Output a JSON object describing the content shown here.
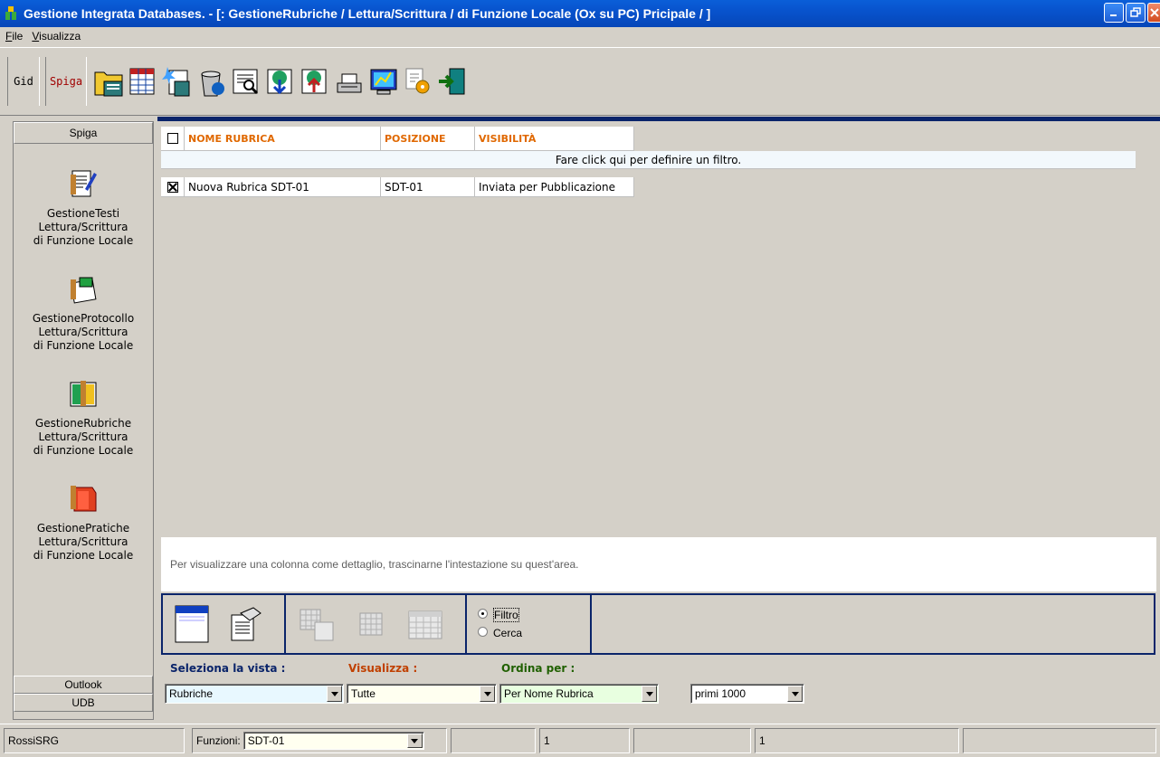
{
  "window": {
    "title": "Gestione Integrata Databases. - [: GestioneRubriche / Lettura/Scrittura / di Funzione Locale (Ox su PC) Pricipale / ]",
    "controls": [
      "minimize-icon",
      "restore-icon",
      "close-icon"
    ]
  },
  "menu": {
    "file": "File",
    "visualizza": "Visualizza"
  },
  "toolbar": {
    "tab_gid": "Gid",
    "tab_spiga": "Spiga",
    "icons": [
      "folder-icon",
      "table-icon",
      "new-document-icon",
      "trash-icon",
      "search-icon",
      "download-icon",
      "upload-icon",
      "printer-icon",
      "chart-icon",
      "settings-icon",
      "exit-icon"
    ]
  },
  "sidebar": {
    "header": "Spiga",
    "items": [
      {
        "name": "GestioneTesti",
        "line2": "Lettura/Scrittura",
        "line3": "di Funzione Locale",
        "icon": "document-pen-icon"
      },
      {
        "name": "GestioneProtocollo",
        "line2": "Lettura/Scrittura",
        "line3": "di Funzione Locale",
        "icon": "stamp-icon"
      },
      {
        "name": "GestioneRubriche",
        "line2": "Lettura/Scrittura",
        "line3": "di Funzione Locale",
        "icon": "address-book-icon"
      },
      {
        "name": "GestionePratiche",
        "line2": "Lettura/Scrittura",
        "line3": "di Funzione Locale",
        "icon": "folder-book-icon"
      }
    ],
    "bottom_outlook": "Outlook",
    "bottom_udb": "UDB"
  },
  "grid": {
    "columns": [
      "NOME RUBRICA",
      "POSIZIONE",
      "VISIBILITÀ"
    ],
    "filter_hint": "Fare click qui per definire un filtro.",
    "rows": [
      {
        "checked": true,
        "nome": "Nuova Rubrica SDT-01",
        "posizione": "SDT-01",
        "visibilita": "Inviata per Pubblicazione"
      }
    ],
    "group_hint": "Per visualizzare una colonna come dettaglio, trascinarne l'intestazione su quest'area."
  },
  "view_panel": {
    "radio_filtro": "Filtro",
    "radio_cerca": "Cerca",
    "selected": "Filtro"
  },
  "bottom": {
    "label_vista": "Seleziona la vista :",
    "label_visualizza": "Visualizza :",
    "label_ordina": "Ordina per :",
    "vista_value": "Rubriche",
    "visualizza_value": "Tutte",
    "ordina_value": "Per Nome Rubrica",
    "limit_value": "primi 1000",
    "colors": {
      "vista_bg": "#e8f8ff",
      "visualizza_bg": "#fffff0",
      "ordina_bg": "#e8ffe0"
    }
  },
  "status": {
    "user": "RossiSRG",
    "funzioni_label": "Funzioni:",
    "funzioni_value": "SDT-01",
    "count1": "1",
    "count2": "1"
  }
}
